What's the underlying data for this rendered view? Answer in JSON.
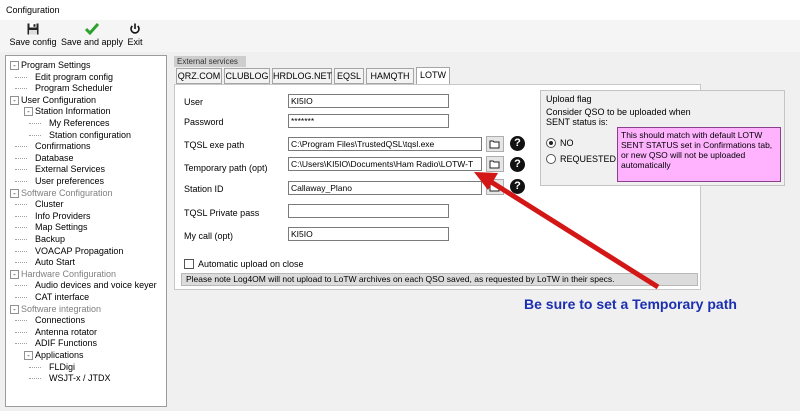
{
  "window": {
    "title": "Configuration"
  },
  "toolbar": {
    "save_config": "Save config",
    "save_and_apply": "Save and apply",
    "exit": "Exit"
  },
  "tree": [
    {
      "label": "Program Settings",
      "level": 0,
      "gray": false,
      "expander": "-"
    },
    {
      "label": "Edit program config",
      "level": 1,
      "gray": false
    },
    {
      "label": "Program Scheduler",
      "level": 1,
      "gray": false
    },
    {
      "label": "User Configuration",
      "level": 0,
      "gray": false,
      "expander": "-"
    },
    {
      "label": "Station Information",
      "level": 1,
      "gray": false,
      "expander": "-"
    },
    {
      "label": "My References",
      "level": 2,
      "gray": false
    },
    {
      "label": "Station configuration",
      "level": 2,
      "gray": false
    },
    {
      "label": "Confirmations",
      "level": 1,
      "gray": false
    },
    {
      "label": "Database",
      "level": 1,
      "gray": false
    },
    {
      "label": "External Services",
      "level": 1,
      "gray": false
    },
    {
      "label": "User preferences",
      "level": 1,
      "gray": false
    },
    {
      "label": "Software Configuration",
      "level": 0,
      "gray": true,
      "expander": "-"
    },
    {
      "label": "Cluster",
      "level": 1,
      "gray": false
    },
    {
      "label": "Info Providers",
      "level": 1,
      "gray": false
    },
    {
      "label": "Map Settings",
      "level": 1,
      "gray": false
    },
    {
      "label": "Backup",
      "level": 1,
      "gray": false
    },
    {
      "label": "VOACAP Propagation",
      "level": 1,
      "gray": false
    },
    {
      "label": "Auto Start",
      "level": 1,
      "gray": false
    },
    {
      "label": "Hardware Configuration",
      "level": 0,
      "gray": true,
      "expander": "-"
    },
    {
      "label": "Audio devices and voice keyer",
      "level": 1,
      "gray": false
    },
    {
      "label": "CAT interface",
      "level": 1,
      "gray": false
    },
    {
      "label": "Software integration",
      "level": 0,
      "gray": true,
      "expander": "-"
    },
    {
      "label": "Connections",
      "level": 1,
      "gray": false
    },
    {
      "label": "Antenna rotator",
      "level": 1,
      "gray": false
    },
    {
      "label": "ADIF Functions",
      "level": 1,
      "gray": false
    },
    {
      "label": "Applications",
      "level": 1,
      "gray": false,
      "expander": "-"
    },
    {
      "label": "FLDigi",
      "level": 2,
      "gray": false
    },
    {
      "label": "WSJT-x / JTDX",
      "level": 2,
      "gray": false
    }
  ],
  "external_services": {
    "group_label": "External services",
    "tabs": [
      "QRZ.COM",
      "CLUBLOG",
      "HRDLOG.NET",
      "EQSL",
      "HAMQTH",
      "LOTW"
    ],
    "active_tab": "LOTW"
  },
  "lotw": {
    "user_label": "User",
    "user_value": "KI5IO",
    "password_label": "Password",
    "password_value": "*******",
    "tqsl_exe_label": "TQSL exe path",
    "tqsl_exe_value": "C:\\Program Files\\TrustedQSL\\tqsl.exe",
    "temp_path_label": "Temporary path (opt)",
    "temp_path_value": "C:\\Users\\KI5IO\\Documents\\Ham Radio\\LOTW-T",
    "station_id_label": "Station ID",
    "station_id_value": "Callaway_Plano",
    "tqsl_pass_label": "TQSL Private pass",
    "tqsl_pass_value": "",
    "my_call_label": "My call (opt)",
    "my_call_value": "KI5IO",
    "auto_upload_label": "Automatic upload on close",
    "note": "Please note Log4OM will not upload to LoTW archives on each QSO saved, as requested by LoTW in their specs."
  },
  "upload_flag": {
    "title": "Upload flag",
    "description": "Consider QSO to be uploaded when SENT status is:",
    "option_no": "NO",
    "option_requested": "REQUESTED",
    "selected": "NO",
    "pink_note": "This should match with default LOTW SENT STATUS set in Confirmations tab, or new QSO will not be uploaded automatically"
  },
  "annotation": {
    "text": "Be sure to set a Temporary path",
    "color": "#1b2fb0"
  },
  "icons": [
    "floppy-disk-icon",
    "checkmark-icon",
    "power-icon",
    "folder-icon",
    "help-icon"
  ]
}
